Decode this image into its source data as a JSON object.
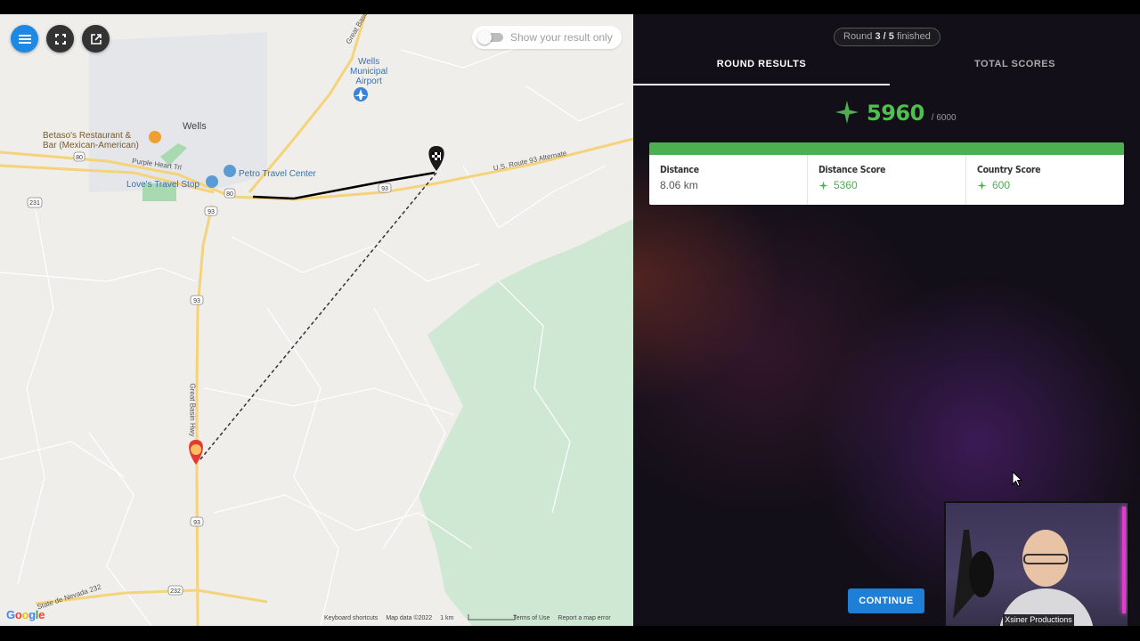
{
  "map": {
    "labels": {
      "wells": "Wells",
      "airport_line1": "Wells",
      "airport_line2": "Municipal",
      "airport_line3": "Airport",
      "restaurant_line1": "Betaso's Restaurant &",
      "restaurant_line2": "Bar (Mexican-American)",
      "petro": "Petro Travel Center",
      "loves": "Love's Travel Stop",
      "purple_heart": "Purple Heart Trl",
      "us93_alt": "U.S. Route 93 Alternate",
      "great_basin_hwy": "Great Basin Hwy",
      "nevada232": "State de Nevada 232",
      "great_basin_top": "Great Basin"
    },
    "shields": [
      "80",
      "231",
      "93",
      "93",
      "93",
      "80",
      "232",
      "93"
    ],
    "toggle_label": "Show your result only",
    "attribution": [
      "Keyboard shortcuts",
      "Map data ©2022",
      "1 km",
      "Terms of Use",
      "Report a map error"
    ],
    "google_letters": [
      "G",
      "o",
      "o",
      "g",
      "l",
      "e"
    ],
    "google_colors": [
      "#4285F4",
      "#EA4335",
      "#FBBC05",
      "#4285F4",
      "#34A853",
      "#EA4335"
    ]
  },
  "results": {
    "round_prefix": "Round ",
    "round_current": "3",
    "round_sep": " / ",
    "round_total": "5",
    "round_suffix": " finished",
    "tabs": [
      "ROUND RESULTS",
      "TOTAL SCORES"
    ],
    "score": "5960",
    "score_max": "/ 6000",
    "cards": [
      {
        "label": "Distance",
        "value": "8.06 km"
      },
      {
        "label": "Distance Score",
        "value": "5360"
      },
      {
        "label": "Country Score",
        "value": "600"
      }
    ],
    "continue_label": "CONTINUE",
    "accent_green": "#4caf50",
    "accent_blue": "#1e7fd6"
  },
  "webcam": {
    "name": "Xsiner Productions"
  }
}
